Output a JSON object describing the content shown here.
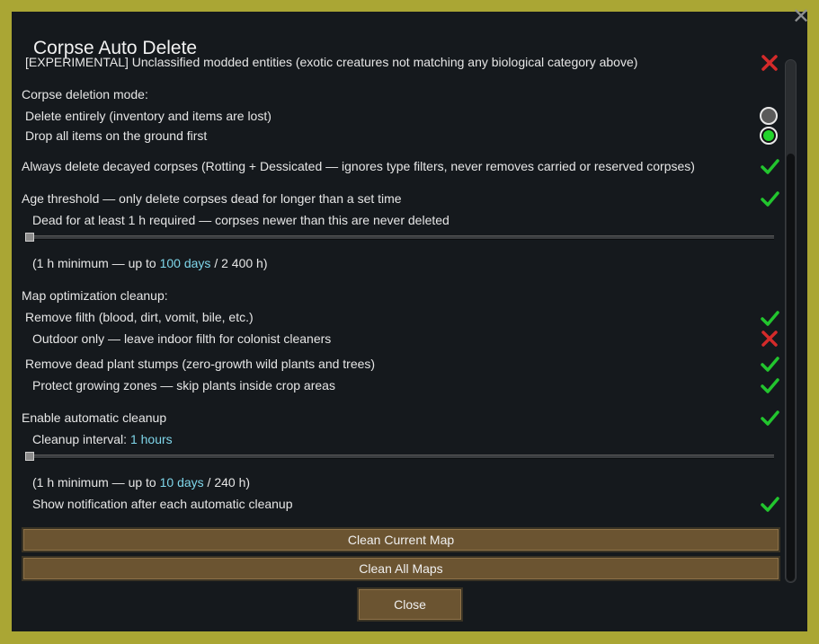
{
  "dialog": {
    "title": "Corpse Auto Delete",
    "close_glyph": "✕"
  },
  "settings": {
    "experimental_label": "[EXPERIMENTAL] Unclassified modded entities (exotic creatures not matching any biological category above)",
    "experimental_value": false,
    "deletion_mode_header": "Corpse deletion mode:",
    "mode_delete_label": "Delete entirely (inventory and items are lost)",
    "mode_drop_label": "Drop all items on the ground first",
    "selected_mode": "drop",
    "decayed_label": "Always delete decayed corpses (Rotting + Dessicated — ignores type filters, never removes carried or reserved corpses)",
    "decayed_value": true,
    "age_label": "Age threshold — only delete corpses dead for longer than a set time",
    "age_value": true,
    "age_sub_label": "Dead for at least 1 h required — corpses newer than this are never deleted",
    "age_slider_fraction": 0,
    "age_range_pre": "(1 h minimum — up to ",
    "age_range_hl": "100 days",
    "age_range_post": " / 2 400 h)",
    "map_header": "Map optimization cleanup:",
    "filth_label": "Remove filth (blood, dirt, vomit, bile, etc.)",
    "filth_value": true,
    "outdoor_label": "Outdoor only — leave indoor filth for colonist cleaners",
    "outdoor_value": false,
    "stumps_label": "Remove dead plant stumps (zero-growth wild plants and trees)",
    "stumps_value": true,
    "protect_label": "Protect growing zones — skip plants inside crop areas",
    "protect_value": true,
    "auto_label": "Enable automatic cleanup",
    "auto_value": true,
    "interval_label_pre": "Cleanup interval: ",
    "interval_label_hl": "1 hours",
    "interval_slider_fraction": 0,
    "interval_range_pre": "(1 h minimum — up to ",
    "interval_range_hl": "10 days",
    "interval_range_post": " / 240 h)",
    "notify_label": "Show notification after each automatic cleanup",
    "notify_value": true
  },
  "buttons": {
    "clean_current": "Clean Current Map",
    "clean_all": "Clean All Maps",
    "close": "Close"
  },
  "colors": {
    "background": "#aaa634",
    "panel": "#15191d",
    "check_on": "#22c52e",
    "check_off": "#d42a2a",
    "highlight": "#7fd6ea",
    "button": "#6b5431"
  },
  "icons": {
    "check": "checkmark-icon",
    "cross": "cross-icon"
  }
}
